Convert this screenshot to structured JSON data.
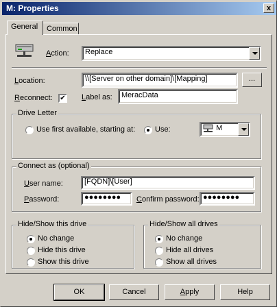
{
  "window": {
    "title": "M: Properties",
    "close_label": "x"
  },
  "tabs": [
    {
      "label": "General"
    },
    {
      "label": "Common"
    }
  ],
  "general": {
    "action_label": "Action:",
    "action_value": "Replace",
    "location_label": "Location:",
    "location_value": "\\\\[Server on other domain]\\[Mapping]",
    "browse_label": "...",
    "reconnect_label": "Reconnect:",
    "reconnect_checked": true,
    "label_as_label": "Label as:",
    "label_as_value": "MeracData"
  },
  "drive_letter": {
    "legend": "Drive Letter",
    "option_first_label": "Use first available, starting at:",
    "option_use_label": "Use:",
    "use_value": "M",
    "selected": "use"
  },
  "connect_as": {
    "legend": "Connect as (optional)",
    "username_label": "User name:",
    "username_value": "[FQDN]\\[User]",
    "password_label": "Password:",
    "password_value": "●●●●●●●●",
    "confirm_label": "Confirm password:",
    "confirm_value": "●●●●●●●●"
  },
  "hide_show_drive": {
    "legend": "Hide/Show this drive",
    "options": [
      "No change",
      "Hide this drive",
      "Show this drive"
    ],
    "selected": "No change"
  },
  "hide_show_all": {
    "legend": "Hide/Show all drives",
    "options": [
      "No change",
      "Hide all drives",
      "Show all drives"
    ],
    "selected": "No change"
  },
  "buttons": {
    "ok": "OK",
    "cancel": "Cancel",
    "apply": "Apply",
    "help": "Help"
  }
}
